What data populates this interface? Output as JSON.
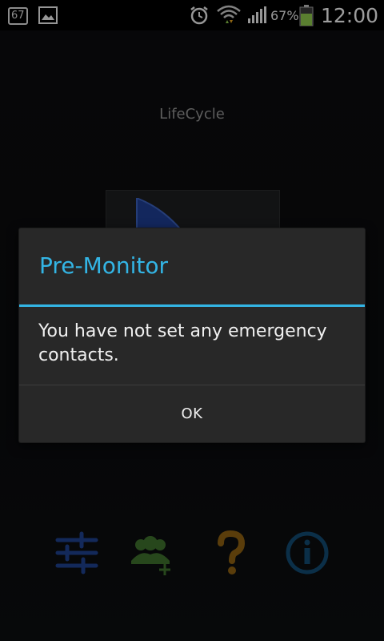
{
  "status_bar": {
    "notification_badge": "67",
    "battery_percent": "67%",
    "clock": "12:00",
    "icons": [
      "notification-badge-icon",
      "gallery-icon",
      "alarm-icon",
      "wifi-icon",
      "signal-icon",
      "battery-icon"
    ],
    "battery_level": 0.67
  },
  "app": {
    "title": "LifeCycle",
    "bottom_icons": [
      "settings-sliders-icon",
      "add-contacts-icon",
      "help-icon",
      "info-icon"
    ]
  },
  "dialog": {
    "title": "Pre-Monitor",
    "message": "You have not set any emergency contacts.",
    "ok_label": "OK"
  },
  "colors": {
    "accent": "#33b5e5",
    "dialog_bg": "#282828",
    "contacts_icon": "#6aa84f",
    "help_icon": "#b8860b",
    "info_icon": "#1f6f9f"
  }
}
